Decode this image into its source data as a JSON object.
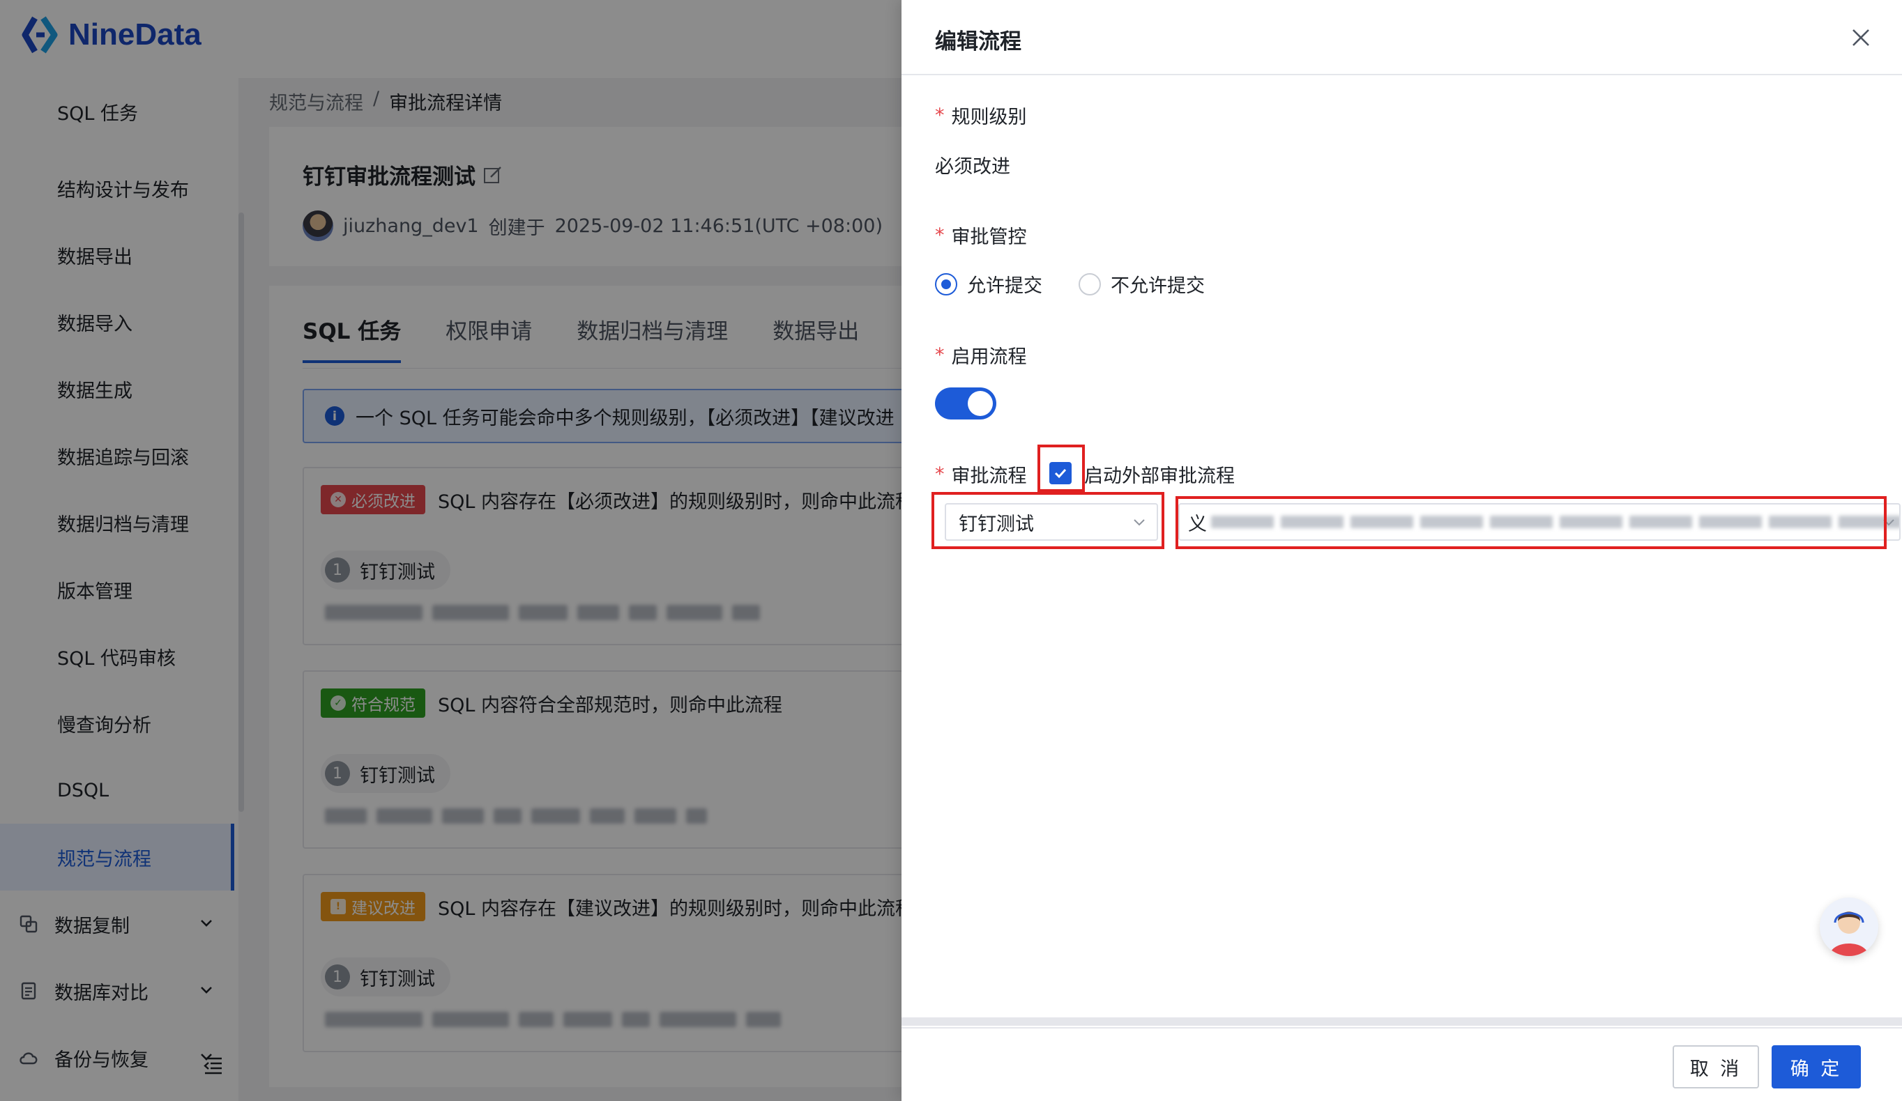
{
  "app": {
    "brand": "NineData",
    "sidebar": {
      "items": [
        {
          "label": "SQL 任务"
        },
        {
          "label": "结构设计与发布"
        },
        {
          "label": "数据导出"
        },
        {
          "label": "数据导入"
        },
        {
          "label": "数据生成"
        },
        {
          "label": "数据追踪与回滚"
        },
        {
          "label": "数据归档与清理"
        },
        {
          "label": "版本管理"
        },
        {
          "label": "SQL 代码审核"
        },
        {
          "label": "慢查询分析"
        },
        {
          "label": "DSQL"
        },
        {
          "label": "规范与流程",
          "active": true
        }
      ],
      "groups": [
        {
          "label": "数据复制",
          "icon": "data-copy-icon"
        },
        {
          "label": "数据库对比",
          "icon": "db-compare-icon"
        },
        {
          "label": "备份与恢复",
          "icon": "cloud-backup-icon"
        }
      ]
    },
    "breadcrumb": {
      "parent": "规范与流程",
      "separator": "/",
      "current": "审批流程详情"
    },
    "flow": {
      "title": "钉钉审批流程测试",
      "creator": "jiuzhang_dev1",
      "created_prefix": "创建于",
      "created_at": "2025-09-02 11:46:51(UTC +08:00)"
    },
    "tabs": [
      {
        "label": "SQL 任务",
        "active": true
      },
      {
        "label": "权限申请"
      },
      {
        "label": "数据归档与清理"
      },
      {
        "label": "数据导出"
      }
    ],
    "alert": "一个 SQL 任务可能会命中多个规则级别，【必须改进】【建议改进",
    "rules": [
      {
        "tag": "必须改进",
        "text": "SQL 内容存在【必须改进】的规则级别时，则命中此流程",
        "step_num": "1",
        "step": "钉钉测试"
      },
      {
        "tag": "符合规范",
        "text": "SQL 内容符合全部规范时，则命中此流程",
        "step_num": "1",
        "step": "钉钉测试"
      },
      {
        "tag": "建议改进",
        "text": "SQL 内容存在【建议改进】的规则级别时，则命中此流程",
        "step_num": "1",
        "step": "钉钉测试"
      }
    ]
  },
  "drawer": {
    "title": "编辑流程",
    "required_mark": "*",
    "fields": {
      "level": {
        "label": "规则级别",
        "value": "必须改进"
      },
      "control": {
        "label": "审批管控",
        "options": [
          "允许提交",
          "不允许提交"
        ],
        "selected": "允许提交"
      },
      "enable": {
        "label": "启用流程",
        "on": true
      },
      "flow": {
        "label": "审批流程",
        "external_label": "启动外部审批流程",
        "external_checked": true,
        "select_type": "钉钉测试",
        "select_flow": "钉钉自定义审批流程",
        "select_flow_suffix": ")"
      }
    },
    "buttons": {
      "cancel": "取 消",
      "ok": "确 定"
    }
  },
  "colors": {
    "primary": "#1d5bd8",
    "danger": "#e5484d",
    "success": "#2ea121",
    "warning": "#f09a1a",
    "highlight": "#e02020"
  }
}
